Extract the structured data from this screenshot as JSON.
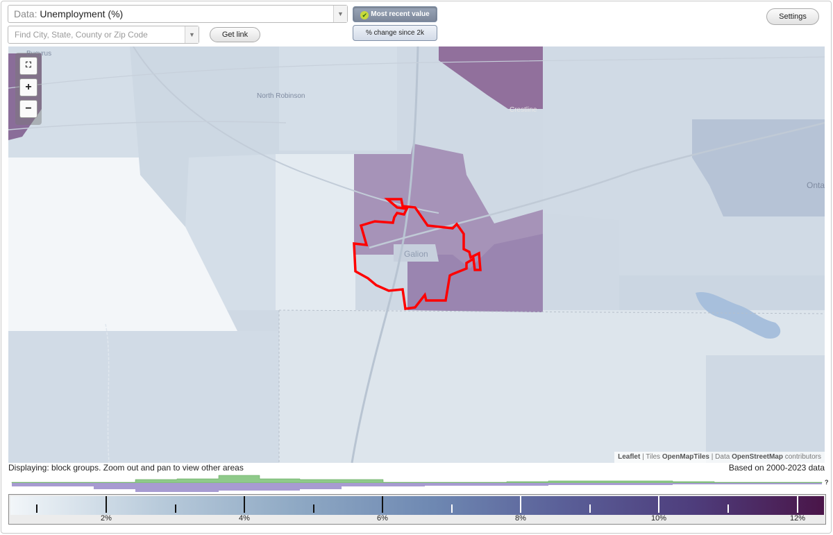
{
  "controls": {
    "data_label": "Data:",
    "data_value": "Unemployment (%)",
    "search_placeholder": "Find City, State, County or Zip Code",
    "get_link": "Get link",
    "settings": "Settings",
    "toggle_most_recent": "Most recent value",
    "toggle_change": "% change since 2k"
  },
  "map": {
    "places": [
      "Bucyrus",
      "North Robinson",
      "Crestline",
      "Galion",
      "Onta"
    ],
    "zoom_in": "+",
    "zoom_out": "−",
    "fullscreen_icon": "fullscreen-icon",
    "attribution": {
      "leaflet": "Leaflet",
      "sep1": " | Tiles ",
      "tiles": "OpenMapTiles",
      "sep2": " | Data ",
      "data": "OpenStreetMap",
      "contrib": " contributors"
    },
    "highlight_color": "#ff0000"
  },
  "footer": {
    "displaying": "Displaying: block groups. Zoom out and pan to view other areas",
    "based_on": "Based on 2000-2023 data",
    "question": "?"
  },
  "legend": {
    "labels": [
      "2%",
      "4%",
      "6%",
      "8%",
      "10%",
      "12%"
    ],
    "min_color": "#f2f6f9",
    "max_color": "#4a1548"
  }
}
